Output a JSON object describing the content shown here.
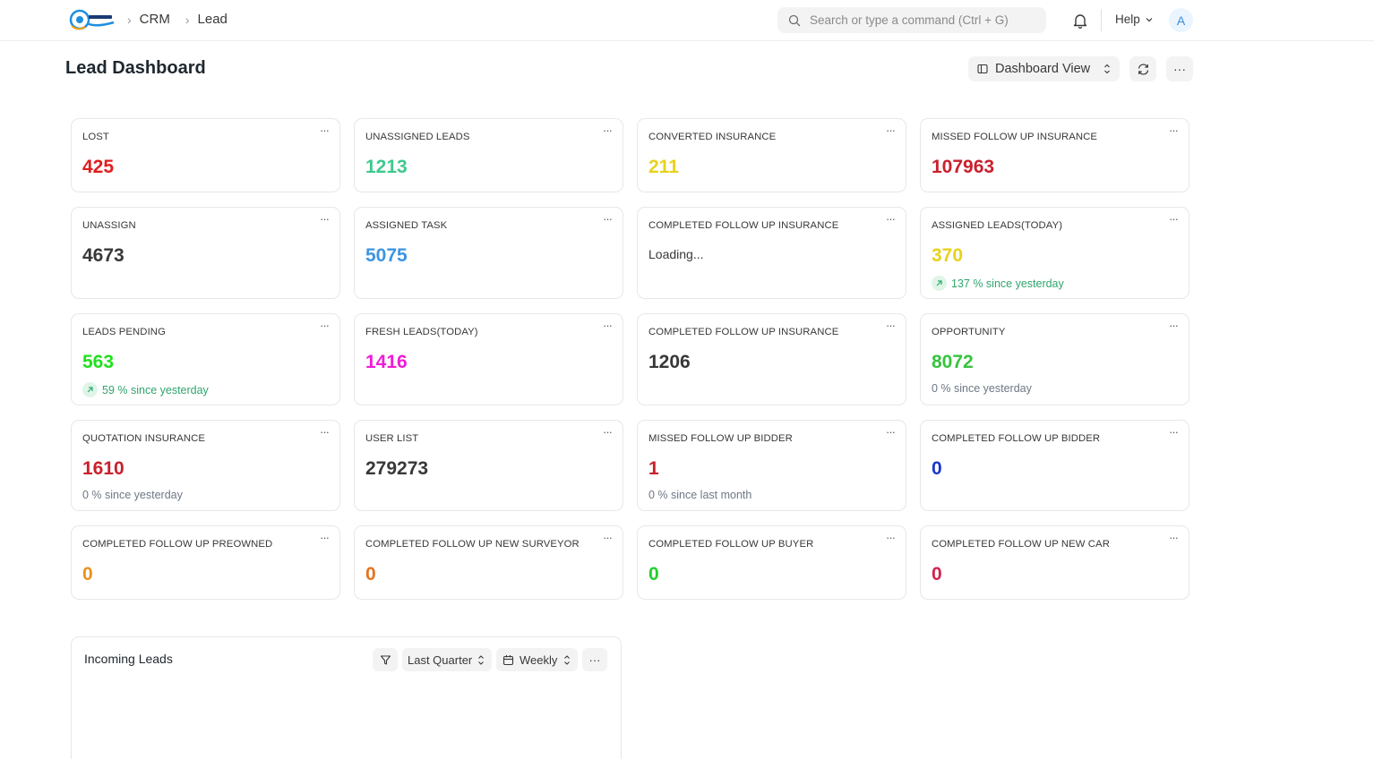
{
  "navbar": {
    "breadcrumbs": [
      "CRM",
      "Lead"
    ],
    "search_placeholder": "Search or type a command (Ctrl + G)",
    "help_label": "Help",
    "avatar_letter": "A"
  },
  "page": {
    "title": "Lead Dashboard",
    "view_button_label": "Dashboard View",
    "menu_icon": "···"
  },
  "cards": [
    {
      "title": "LOST",
      "value": "425",
      "color": "#e11d1d"
    },
    {
      "title": "UNASSIGNED LEADS",
      "value": "1213",
      "color": "#3ec98e"
    },
    {
      "title": "CONVERTED INSURANCE",
      "value": "211",
      "color": "#e8d21e"
    },
    {
      "title": "MISSED FOLLOW UP INSURANCE",
      "value": "107963",
      "color": "#c9202d"
    },
    {
      "title": "UNASSIGN",
      "value": "4673",
      "color": "#383838"
    },
    {
      "title": "ASSIGNED TASK",
      "value": "5075",
      "color": "#3d95e0"
    },
    {
      "title": "COMPLETED FOLLOW UP INSURANCE",
      "value": "Loading...",
      "color": "#383838",
      "loading": true
    },
    {
      "title": "ASSIGNED LEADS(TODAY)",
      "value": "370",
      "color": "#e8d21e",
      "stat": "137 % since yesterday",
      "trend": "up"
    },
    {
      "title": "LEADS PENDING",
      "value": "563",
      "color": "#22e01d",
      "stat": "59 % since yesterday",
      "trend": "up"
    },
    {
      "title": "FRESH LEADS(TODAY)",
      "value": "1416",
      "color": "#f01cd6"
    },
    {
      "title": "COMPLETED FOLLOW UP INSURANCE",
      "value": "1206",
      "color": "#383838"
    },
    {
      "title": "OPPORTUNITY",
      "value": "8072",
      "color": "#36c43e",
      "stat": "0 % since yesterday",
      "trend": "flat"
    },
    {
      "title": "QUOTATION INSURANCE",
      "value": "1610",
      "color": "#c9202d",
      "stat": "0 % since yesterday",
      "trend": "flat"
    },
    {
      "title": "USER LIST",
      "value": "279273",
      "color": "#383838"
    },
    {
      "title": "MISSED FOLLOW UP BIDDER",
      "value": "1",
      "color": "#c9202d",
      "stat": "0 % since last month",
      "trend": "flat"
    },
    {
      "title": "COMPLETED FOLLOW UP BIDDER",
      "value": "0",
      "color": "#1837c9"
    },
    {
      "title": "COMPLETED FOLLOW UP PREOWNED",
      "value": "0",
      "color": "#e8921e"
    },
    {
      "title": "COMPLETED FOLLOW UP NEW SURVEYOR",
      "value": "0",
      "color": "#e8721e"
    },
    {
      "title": "COMPLETED FOLLOW UP BUYER",
      "value": "0",
      "color": "#22d02a"
    },
    {
      "title": "COMPLETED FOLLOW UP NEW CAR",
      "value": "0",
      "color": "#d1234f"
    }
  ],
  "chart_card": {
    "title": "Incoming Leads",
    "timespan": "Last Quarter",
    "interval": "Weekly"
  },
  "icons": {
    "logo": "carsindia-logo",
    "search": "search-icon",
    "bell": "bell-icon",
    "refresh": "refresh-icon",
    "filter": "filter-icon",
    "calendar": "calendar-icon"
  }
}
